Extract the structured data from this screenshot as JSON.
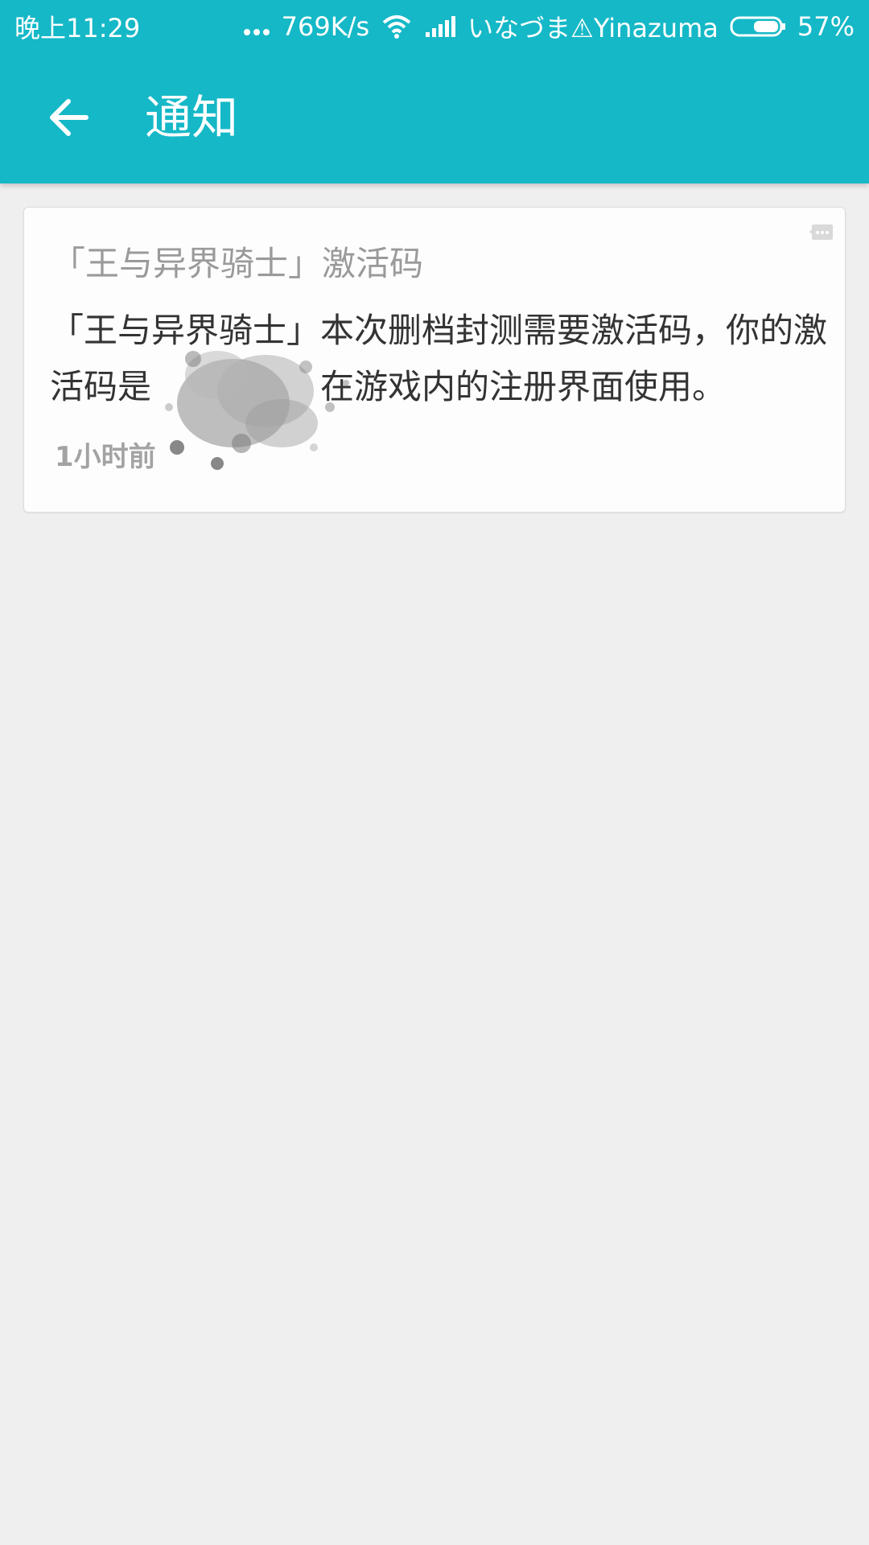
{
  "status_bar": {
    "time": "晚上11:29",
    "network_speed": "769K/s",
    "carrier": "いなづま⚠Yinazuma",
    "battery_percent": "57%",
    "icons": [
      "more-dots-icon",
      "wifi-icon",
      "signal-icon",
      "battery-icon"
    ]
  },
  "toolbar": {
    "title": "通知",
    "back_icon": "arrow-left-icon"
  },
  "notifications": [
    {
      "title": "「王与异界骑士」激活码",
      "body_before": "「王与异界骑士」本次删档封测需要激活码，你的激活码是",
      "body_after": "在游戏内的注册界面使用。",
      "time": "1小时前",
      "menu_icon": "more-icon"
    }
  ],
  "colors": {
    "accent": "#15b8c7",
    "background": "#efefef",
    "card": "#fdfdfd",
    "title_gray": "#9a9a9a",
    "body_text": "#333333"
  }
}
